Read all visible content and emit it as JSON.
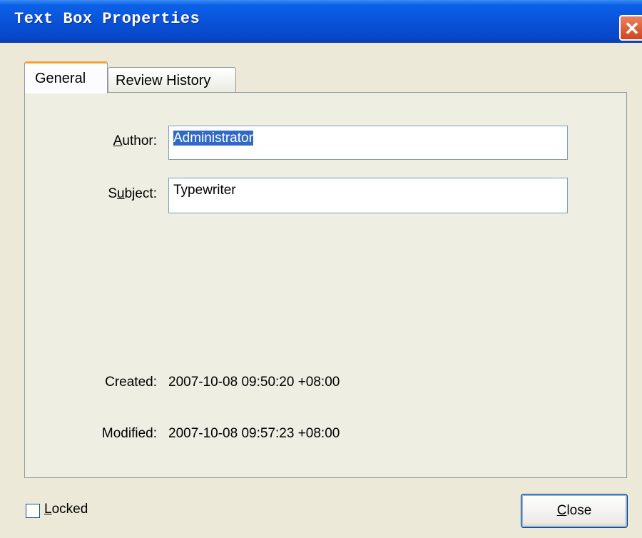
{
  "window": {
    "title": "Text Box Properties",
    "close_glyph": "✕"
  },
  "tabs": [
    {
      "label": "General",
      "selected": true
    },
    {
      "label": "Review History",
      "selected": false
    }
  ],
  "general": {
    "author": {
      "label_first": "A",
      "label_rest": "uthor:",
      "value": "Administrator"
    },
    "subject": {
      "label_first": "S",
      "label_mid_u": "u",
      "label_rest": "bject:",
      "value": "Typewriter"
    },
    "created": {
      "label": "Created:",
      "value": "2007-10-08 09:50:20 +08:00"
    },
    "modified": {
      "label": "Modified:",
      "value": "2007-10-08 09:57:23 +08:00"
    }
  },
  "footer": {
    "locked": {
      "label_first": "L",
      "label_rest": "ocked",
      "checked": false
    },
    "close_button": {
      "label_first": "C",
      "label_rest": "lose"
    }
  }
}
